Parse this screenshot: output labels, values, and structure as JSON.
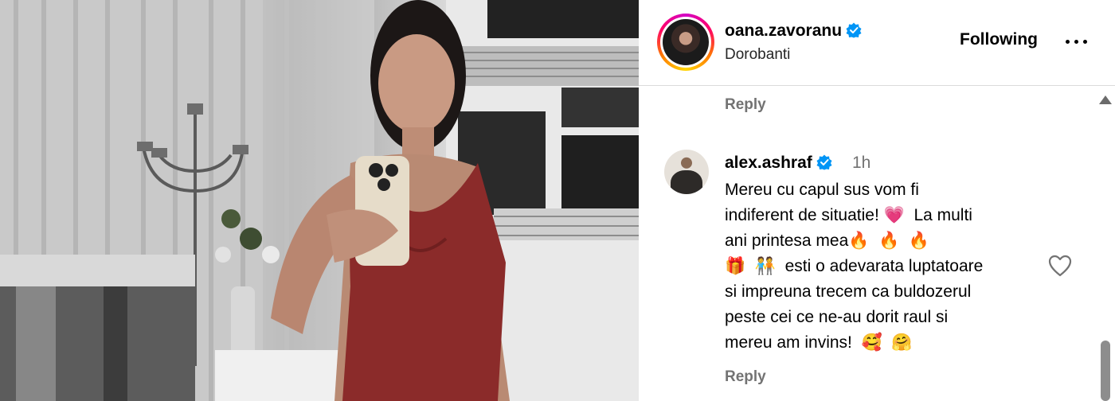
{
  "post": {
    "image_alt": "Mirror selfie of a woman in a red dress holding a phone",
    "owner": {
      "username": "oana.zavoranu",
      "verified": true,
      "location": "Dorobanti"
    },
    "follow_label": "Following",
    "more_label": "More options"
  },
  "comments": {
    "previous_reply_label": "Reply",
    "items": [
      {
        "username": "alex.ashraf",
        "verified": true,
        "time": "1h",
        "text": "Mereu cu capul sus vom fi\nindiferent de situatie! 💗  La multi\nani printesa mea🔥  🔥  🔥\n🎁  🧑‍🤝‍🧑  esti o adevarata luptatoare\nsi impreuna trecem ca buldozerul\npeste cei ce ne-au dorit raul si\nmereu am invins!  🥰  🤗",
        "reply_label": "Reply"
      }
    ]
  },
  "colors": {
    "verified": "#0095f6",
    "secondary_text": "#737373",
    "divider": "#dbdbdb"
  }
}
